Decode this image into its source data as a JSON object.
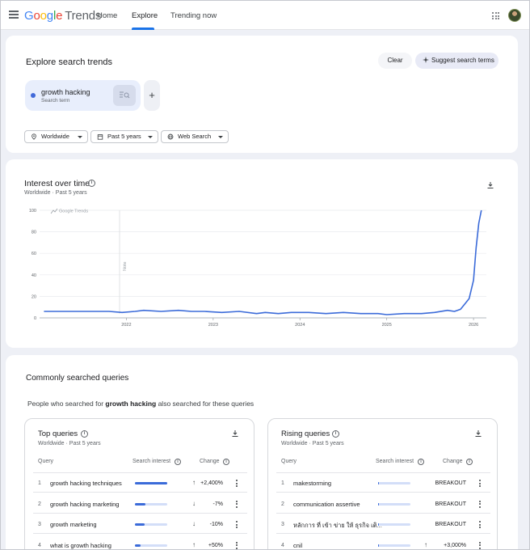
{
  "topbar": {
    "logo_google": [
      "G",
      "o",
      "o",
      "g",
      "l",
      "e"
    ],
    "logo_trends": "Trends",
    "nav": {
      "home": "Home",
      "explore": "Explore",
      "trending": "Trending now"
    }
  },
  "explore": {
    "title": "Explore search trends",
    "clear_label": "Clear",
    "suggest_label": "Suggest search terms",
    "term": {
      "name": "growth hacking",
      "type": "Search term",
      "color": "#4169d9"
    },
    "add_label": "+",
    "filters": {
      "region": "Worldwide",
      "time": "Past 5 years",
      "property": "Web Search"
    }
  },
  "interest": {
    "title": "Interest over time",
    "subtitle": "Worldwide  ·  Past 5 years",
    "watermark": "Google Trends",
    "note_label": "Note"
  },
  "chart_data": {
    "type": "line",
    "title": "Interest over time",
    "xlabel": "",
    "ylabel": "",
    "ylim": [
      0,
      100
    ],
    "yticks": [
      0,
      20,
      40,
      60,
      80,
      100
    ],
    "xticks": [
      "2022",
      "2023",
      "2024",
      "2025",
      "2026"
    ],
    "grid": true,
    "series": [
      {
        "name": "growth hacking",
        "color": "#3b6bd9",
        "x": [
          2021.05,
          2021.3,
          2021.6,
          2021.8,
          2021.95,
          2022.1,
          2022.2,
          2022.4,
          2022.6,
          2022.75,
          2022.9,
          2023.1,
          2023.3,
          2023.5,
          2023.6,
          2023.75,
          2023.9,
          2024.1,
          2024.3,
          2024.5,
          2024.7,
          2024.9,
          2025.0,
          2025.2,
          2025.4,
          2025.55,
          2025.7,
          2025.78,
          2025.85,
          2025.9,
          2025.95,
          2026.0,
          2026.03,
          2026.06,
          2026.09
        ],
        "values": [
          6,
          6,
          6,
          6,
          5,
          6,
          7,
          6,
          7,
          6,
          6,
          5,
          6,
          4,
          5,
          4,
          5,
          5,
          4,
          5,
          4,
          4,
          3,
          4,
          4,
          5,
          7,
          6,
          8,
          13,
          18,
          35,
          65,
          88,
          100
        ]
      }
    ]
  },
  "queries": {
    "title": "Commonly searched queries",
    "desc_prefix": "People who searched for ",
    "desc_term": "growth hacking",
    "desc_suffix": " also searched for these queries",
    "top": {
      "title": "Top queries",
      "subtitle": "Worldwide  ·  Past 5 years",
      "col_query": "Query",
      "col_interest": "Search interest",
      "col_change": "Change",
      "rows": [
        {
          "idx": "1",
          "query": "growth hacking techniques",
          "interest": 1.0,
          "dir": "up",
          "change": "+2,400%"
        },
        {
          "idx": "2",
          "query": "growth hacking marketing",
          "interest": 0.32,
          "dir": "down",
          "change": "-7%"
        },
        {
          "idx": "3",
          "query": "growth marketing",
          "interest": 0.3,
          "dir": "down",
          "change": "-10%"
        },
        {
          "idx": "4",
          "query": "what is growth hacking",
          "interest": 0.18,
          "dir": "up",
          "change": "+50%"
        }
      ]
    },
    "rising": {
      "title": "Rising queries",
      "subtitle": "Worldwide  ·  Past 5 years",
      "col_query": "Query",
      "col_interest": "Search interest",
      "col_change": "Change",
      "rows": [
        {
          "idx": "1",
          "query": "makestorming",
          "interest": 0.02,
          "dir": "",
          "change": "BREAKOUT"
        },
        {
          "idx": "2",
          "query": "communication assertive",
          "interest": 0.02,
          "dir": "",
          "change": "BREAKOUT"
        },
        {
          "idx": "3",
          "query": "หลักการ ที่ เข้า ข่าย ให้ ธุรกิจ เติ...",
          "interest": 0.02,
          "dir": "",
          "change": "BREAKOUT"
        },
        {
          "idx": "4",
          "query": "cnil",
          "interest": 0.02,
          "dir": "up",
          "change": "+3,000%"
        }
      ]
    }
  }
}
